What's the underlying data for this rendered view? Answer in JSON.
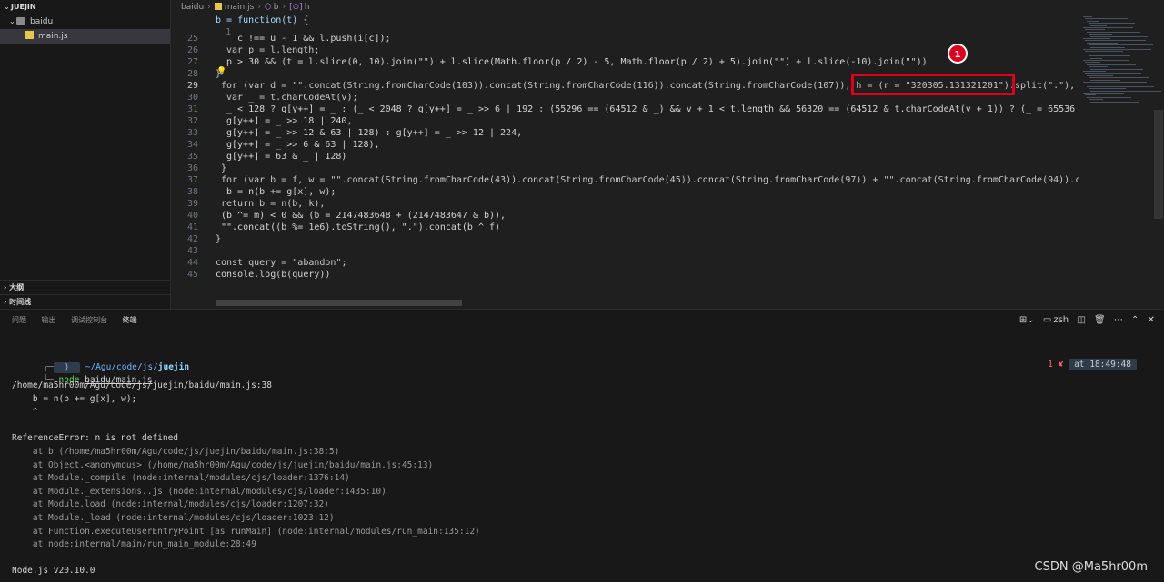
{
  "explorer": {
    "root": "JUEJIN",
    "folder": "baidu",
    "file": "main.js",
    "outline": "大纲",
    "timeline": "时间线"
  },
  "breadcrumb": {
    "folder": "baidu",
    "file": "main.js",
    "symbol_b": "b",
    "symbol_h": "h"
  },
  "code": {
    "first_line_number": "1",
    "first_line_text": "b = function(t) {",
    "lines": [
      {
        "n": "25",
        "t": "c !== u - 1 && l.push(i[c]);"
      },
      {
        "n": "26",
        "t": "var p = l.length;"
      },
      {
        "n": "27",
        "t": "p > 30 && (t = l.slice(0, 10).join(\"\") + l.slice(Math.floor(p / 2) - 5, Math.floor(p / 2) + 5).join(\"\") + l.slice(-10).join(\"\"))"
      },
      {
        "n": "28",
        "t": "}"
      },
      {
        "n": "29",
        "t": "for (var d = \"\".concat(String.fromCharCode(103)).concat(String.fromCharCode(116)).concat(String.fromCharCode(107)), h = (r = \"320305.131321201\").split(\".\"),"
      },
      {
        "n": "30",
        "t": "var _ = t.charCodeAt(v);"
      },
      {
        "n": "31",
        "t": "_ < 128 ? g[y++] = _ : (_ < 2048 ? g[y++] = _ >> 6 | 192 : (55296 == (64512 & _) && v + 1 < t.length && 56320 == (64512 & t.charCodeAt(v + 1)) ? (_ = 65536"
      },
      {
        "n": "32",
        "t": "g[y++] = _ >> 18 | 240,"
      },
      {
        "n": "33",
        "t": "g[y++] = _ >> 12 & 63 | 128) : g[y++] = _ >> 12 | 224,"
      },
      {
        "n": "34",
        "t": "g[y++] = _ >> 6 & 63 | 128),"
      },
      {
        "n": "35",
        "t": "g[y++] = 63 & _ | 128)"
      },
      {
        "n": "36",
        "t": "}"
      },
      {
        "n": "37",
        "t": "for (var b = f, w = \"\".concat(String.fromCharCode(43)).concat(String.fromCharCode(45)).concat(String.fromCharCode(97)) + \"\".concat(String.fromCharCode(94)).c"
      },
      {
        "n": "38",
        "t": "b = n(b += g[x], w);"
      },
      {
        "n": "39",
        "t": "return b = n(b, k),"
      },
      {
        "n": "40",
        "t": "(b ^= m) < 0 && (b = 2147483648 + (2147483647 & b)),"
      },
      {
        "n": "41",
        "t": "\"\".concat((b %= 1e6).toString(), \".\").concat(b ^ f)"
      },
      {
        "n": "42",
        "t": "}"
      },
      {
        "n": "43",
        "t": ""
      },
      {
        "n": "44",
        "t": "const query = \"abandon\";"
      },
      {
        "n": "45",
        "t": "console.log(b(query))"
      }
    ]
  },
  "annotations": {
    "badge1": "1",
    "badge2": "2"
  },
  "panel": {
    "tabs": [
      "问题",
      "输出",
      "调试控制台",
      "终端"
    ],
    "active_tab": "终端",
    "shell": "zsh"
  },
  "terminal": {
    "prompt_dir_prefix": "~/Agu/code/js/",
    "prompt_dir_last": "juejin",
    "command_prefix": "node ",
    "command_arg": "baidu/main.js",
    "status_code": "1",
    "status_mark": "✘",
    "status_time": "at 18:49:48",
    "lines": [
      "/home/ma5hr00m/Agu/code/js/juejin/baidu/main.js:38",
      "    b = n(b += g[x], w);",
      "    ^",
      "",
      "ReferenceError: n is not defined",
      "    at b (/home/ma5hr00m/Agu/code/js/juejin/baidu/main.js:38:5)",
      "    at Object.<anonymous> (/home/ma5hr00m/Agu/code/js/juejin/baidu/main.js:45:13)",
      "    at Module._compile (node:internal/modules/cjs/loader:1376:14)",
      "    at Module._extensions..js (node:internal/modules/cjs/loader:1435:10)",
      "    at Module.load (node:internal/modules/cjs/loader:1207:32)",
      "    at Module._load (node:internal/modules/cjs/loader:1023:12)",
      "    at Function.executeUserEntryPoint [as runMain] (node:internal/modules/run_main:135:12)",
      "    at node:internal/main/run_main_module:28:49",
      "",
      "Node.js v20.10.0"
    ]
  },
  "watermark": "CSDN @Ma5hr00m",
  "colors": {
    "highlight": "#e0001b",
    "editor_bg": "#1f1f1f",
    "panel_bg": "#181818"
  }
}
